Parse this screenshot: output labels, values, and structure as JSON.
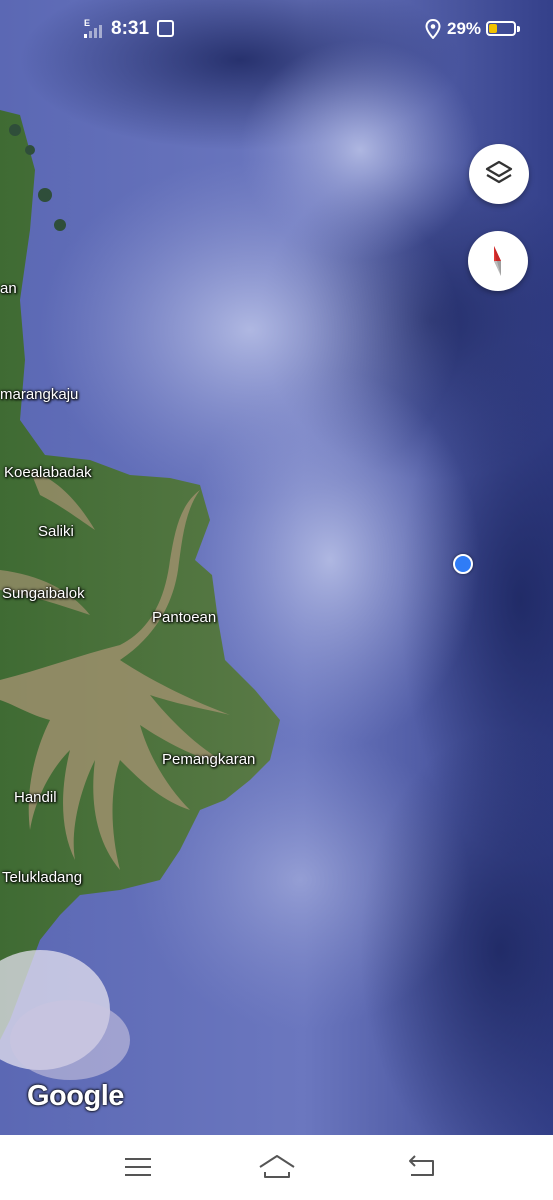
{
  "status_bar": {
    "network_label": "E",
    "time": "8:31",
    "battery_percent": "29%",
    "battery_level": 0.29,
    "icons": [
      "signal-icon",
      "gallery-icon",
      "location-icon",
      "battery-icon"
    ]
  },
  "map": {
    "type": "satellite",
    "labels": [
      {
        "name": "an"
      },
      {
        "name": "marangkaju"
      },
      {
        "name": "Koealabadak"
      },
      {
        "name": "Saliki"
      },
      {
        "name": "Sungaibalok"
      },
      {
        "name": "Pantoean"
      },
      {
        "name": "Pemangkaran"
      },
      {
        "name": "Handil"
      },
      {
        "name": "Telukladang"
      }
    ],
    "logo": "Google"
  },
  "controls": {
    "layers_icon": "layers-icon",
    "compass_icon": "compass-icon"
  },
  "nav_bar": {
    "icons": [
      "menu-icon",
      "home-icon",
      "back-icon"
    ]
  }
}
